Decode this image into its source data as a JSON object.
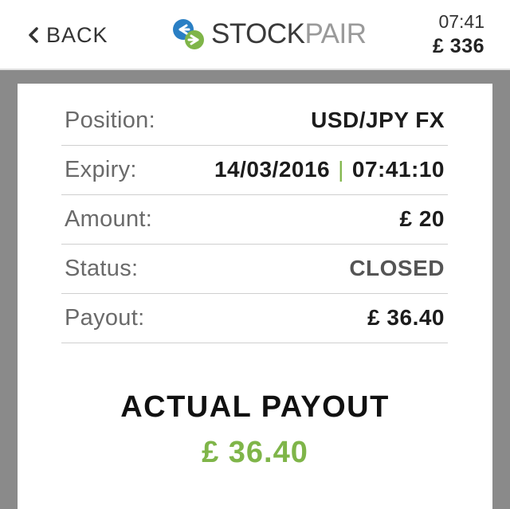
{
  "header": {
    "back_label": "BACK",
    "logo_part1": "STOCK",
    "logo_part2": "PAIR",
    "time": "07:41",
    "balance": "£ 336"
  },
  "details": {
    "position": {
      "label": "Position:",
      "value": "USD/JPY FX"
    },
    "expiry": {
      "label": "Expiry:",
      "date": "14/03/2016",
      "separator": "|",
      "time": "07:41:10"
    },
    "amount": {
      "label": "Amount:",
      "value": "£ 20"
    },
    "status": {
      "label": "Status:",
      "value": "CLOSED"
    },
    "payout": {
      "label": "Payout:",
      "value": "£ 36.40"
    }
  },
  "actual_payout": {
    "title": "ACTUAL PAYOUT",
    "value": "£ 36.40"
  },
  "colors": {
    "accent_green": "#7fb549",
    "logo_blue": "#2a7fc4",
    "background_gray": "#8a8a8a"
  }
}
